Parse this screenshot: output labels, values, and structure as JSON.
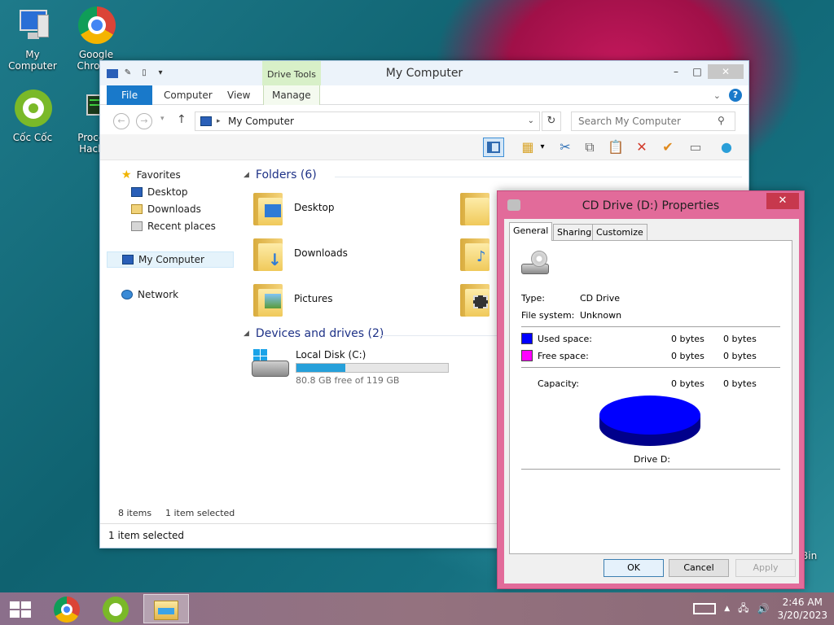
{
  "desktop": {
    "icons": [
      {
        "label": "My Computer"
      },
      {
        "label": "Google Chrome"
      },
      {
        "label": "Cốc Cốc"
      },
      {
        "label": "Process Hacker"
      }
    ],
    "recycle_bin_label": "Bin"
  },
  "explorer": {
    "title": "My Computer",
    "context_tab": "Drive Tools",
    "tabs": {
      "file": "File",
      "computer": "Computer",
      "view": "View",
      "manage": "Manage"
    },
    "address": "My Computer",
    "search_placeholder": "Search My Computer",
    "nav": {
      "favorites": "Favorites",
      "desktop": "Desktop",
      "downloads": "Downloads",
      "recent": "Recent places",
      "my_computer": "My Computer",
      "network": "Network"
    },
    "folders_header": "Folders (6)",
    "folders": [
      {
        "label": "Desktop"
      },
      {
        "label": "Downloads"
      },
      {
        "label": "Pictures"
      }
    ],
    "devices_header": "Devices and drives (2)",
    "drive_c": {
      "name": "Local Disk (C:)",
      "free_text": "80.8 GB free of 119 GB",
      "used_fraction": 0.32
    },
    "status_items": "8 items",
    "status_selected": "1 item selected",
    "status_bar": "1 item selected"
  },
  "dialog": {
    "title": "CD Drive (D:) Properties",
    "tabs": {
      "general": "General",
      "sharing": "Sharing",
      "customize": "Customize"
    },
    "type_label": "Type:",
    "type_value": "CD Drive",
    "fs_label": "File system:",
    "fs_value": "Unknown",
    "used_label": "Used space:",
    "used_bytes": "0 bytes",
    "used_bytes2": "0 bytes",
    "free_label": "Free space:",
    "free_bytes": "0 bytes",
    "free_bytes2": "0 bytes",
    "capacity_label": "Capacity:",
    "capacity_bytes": "0 bytes",
    "capacity_bytes2": "0 bytes",
    "drive_caption": "Drive D:",
    "buttons": {
      "ok": "OK",
      "cancel": "Cancel",
      "apply": "Apply"
    },
    "colors": {
      "used": "#0000ff",
      "free": "#ff00ff"
    }
  },
  "taskbar": {
    "time": "2:46 AM",
    "date": "3/20/2023"
  }
}
